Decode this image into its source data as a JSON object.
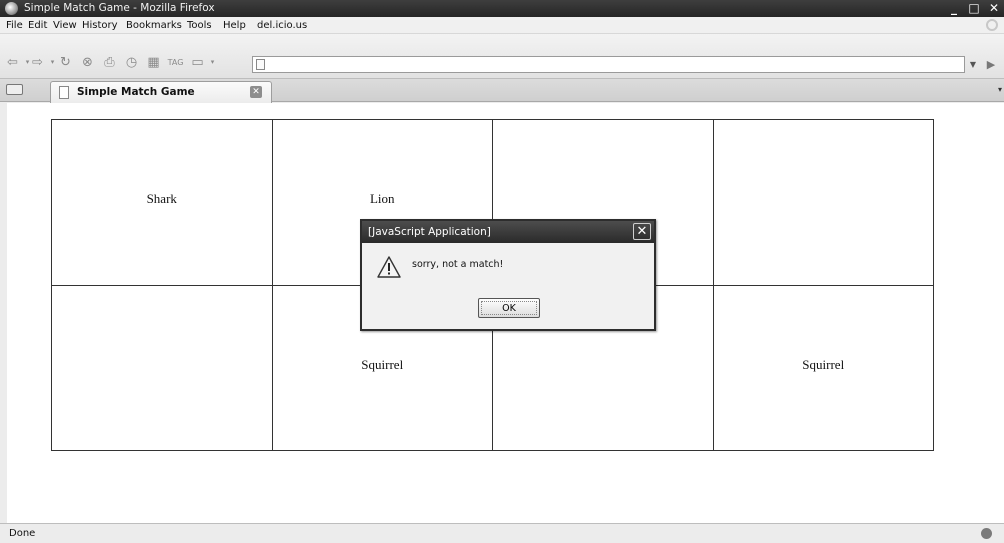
{
  "window": {
    "title": "Simple Match Game - Mozilla Firefox",
    "controls": {
      "minimize": "_",
      "maximize": "□",
      "close": "✕"
    }
  },
  "menubar": {
    "items": [
      "File",
      "Edit",
      "View",
      "History",
      "Bookmarks",
      "Tools",
      "Help",
      "del.icio.us"
    ]
  },
  "toolbar": {
    "icons": [
      "back-icon",
      "forward-icon",
      "reload-icon",
      "stop-icon",
      "print-icon",
      "history-icon",
      "bookmark-icon",
      "tag-icon",
      "page-menu-icon"
    ],
    "url_value": ""
  },
  "tabs": [
    {
      "label": "Simple Match Game",
      "active": true
    }
  ],
  "game": {
    "cells": [
      [
        "Shark",
        "Lion",
        "",
        ""
      ],
      [
        "",
        "Squirrel",
        "",
        "Squirrel"
      ]
    ]
  },
  "dialog": {
    "title": "[JavaScript Application]",
    "message": "sorry, not a match!",
    "ok_label": "OK",
    "icon": "warning-icon"
  },
  "statusbar": {
    "text": "Done"
  },
  "colors": {
    "titlebar": "#2f2f2f",
    "chrome": "#ececec",
    "grid_line": "#333333",
    "dialog_title": "#3a3a3a"
  }
}
